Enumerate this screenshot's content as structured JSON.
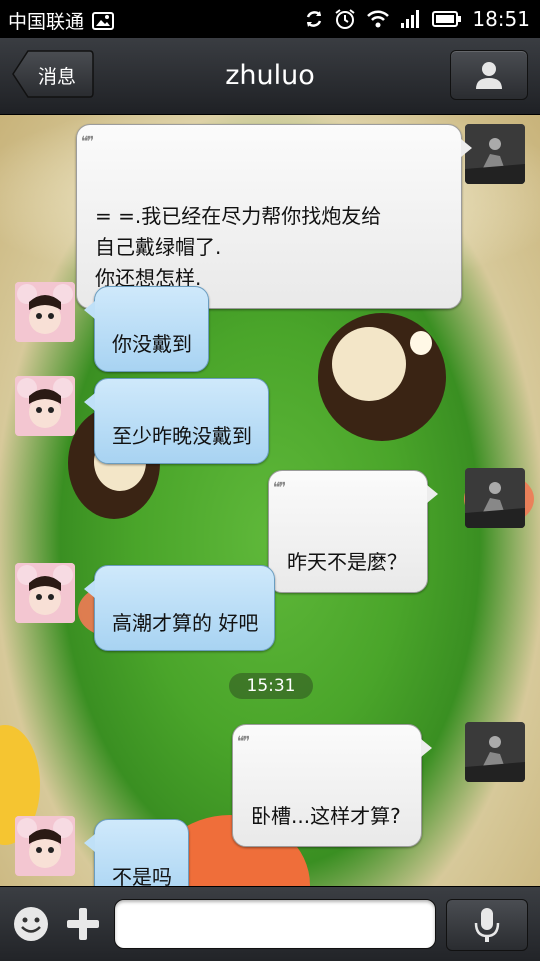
{
  "status_bar": {
    "carrier": "中国联通",
    "time": "18:51",
    "icons": [
      "image-icon",
      "sync-icon",
      "alarm-icon",
      "wifi-icon",
      "signal-icon",
      "battery-icon"
    ]
  },
  "header": {
    "back_label": "消息",
    "title": "zhuluo",
    "profile_icon": "person-icon"
  },
  "messages": [
    {
      "side": "self",
      "text": "= =.我已经在尽力帮你找炮友给\n自己戴绿帽了.\n你还想怎样."
    },
    {
      "side": "other",
      "text": "你没戴到"
    },
    {
      "side": "other",
      "text": "至少昨晚没戴到"
    },
    {
      "side": "self",
      "text": "昨天不是麼？"
    },
    {
      "side": "other",
      "text": "高潮才算的 好吧"
    },
    {
      "side": "self",
      "text": "卧槽...这样才算?"
    },
    {
      "side": "other",
      "text": "不是吗"
    }
  ],
  "timestamp": "15:31",
  "input_bar": {
    "emoji_icon": "smiley-icon",
    "plus_icon": "plus-icon",
    "voice_icon": "microphone-icon",
    "text_value": ""
  },
  "colors": {
    "bubble_self": "#eeeeee",
    "bubble_other": "#b6dcf6",
    "header": "#2b2d31"
  }
}
